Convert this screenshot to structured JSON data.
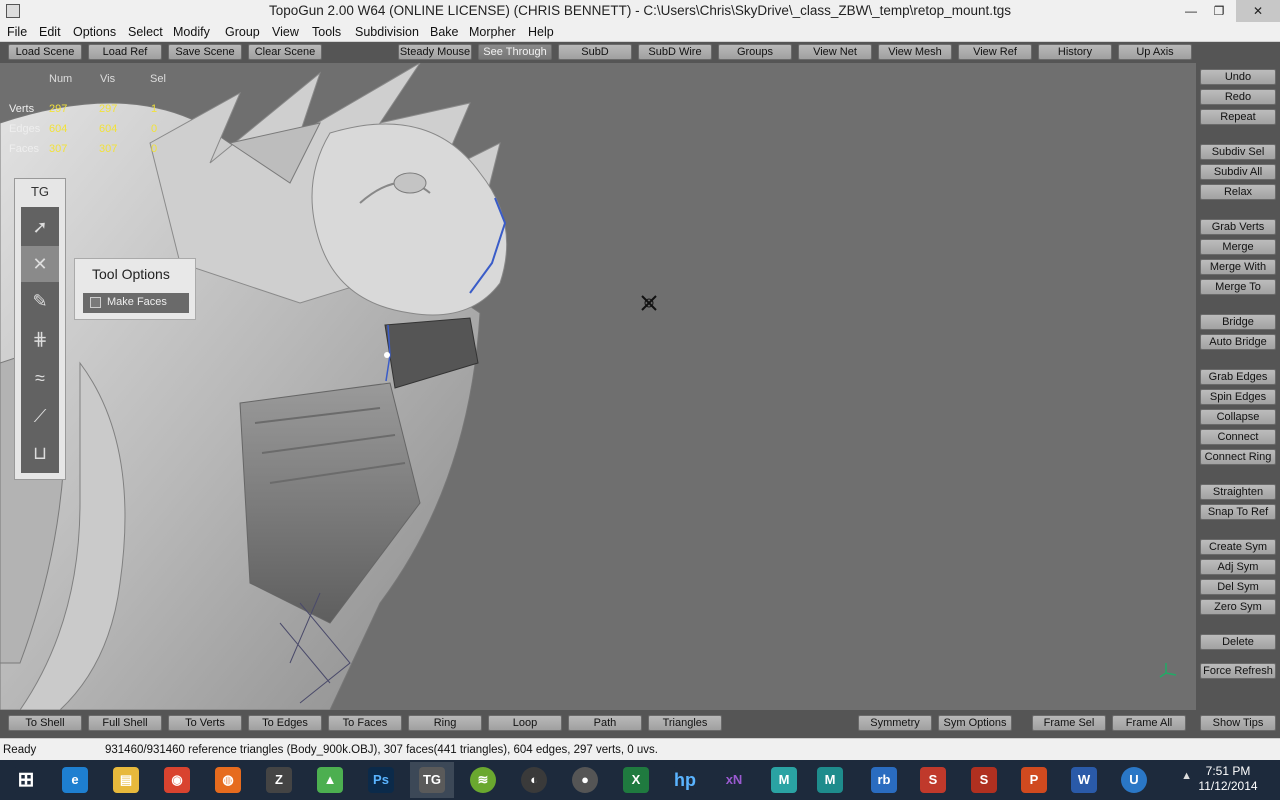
{
  "window": {
    "title": "TopoGun 2.00 W64  (ONLINE LICENSE) (CHRIS BENNETT) - C:\\Users\\Chris\\SkyDrive\\_class_ZBW\\_temp\\retop_mount.tgs",
    "minimize": "—",
    "maximize": "❐",
    "close": "✕"
  },
  "menu": [
    "File",
    "Edit",
    "Options",
    "Select",
    "Modify",
    "Group",
    "View",
    "Tools",
    "Subdivision",
    "Bake",
    "Morpher",
    "Help"
  ],
  "top_toolbar": {
    "left": [
      "Load Scene",
      "Load Ref",
      "Save Scene",
      "Clear Scene"
    ],
    "right": [
      "Steady Mouse",
      "See Through",
      "SubD",
      "SubD Wire",
      "Groups",
      "View Net",
      "View Mesh",
      "View Ref",
      "History",
      "Up Axis"
    ]
  },
  "stats": {
    "headers": [
      "Num",
      "Vis",
      "Sel"
    ],
    "rows": [
      {
        "label": "Verts",
        "num": "297",
        "vis": "297",
        "sel": "1"
      },
      {
        "label": "Edges",
        "num": "604",
        "vis": "604",
        "sel": "0"
      },
      {
        "label": "Faces",
        "num": "307",
        "vis": "307",
        "sel": "0"
      }
    ]
  },
  "tg_panel": {
    "title": "TG",
    "tools": [
      {
        "icon": "select-arrow-icon",
        "glyph": "➚"
      },
      {
        "icon": "cross-tool-icon",
        "glyph": "✕"
      },
      {
        "icon": "pencil-icon",
        "glyph": "✎"
      },
      {
        "icon": "grid-tool-icon",
        "glyph": "⋕"
      },
      {
        "icon": "relax-brush-icon",
        "glyph": "≈"
      },
      {
        "icon": "brush-icon",
        "glyph": "⟋"
      },
      {
        "icon": "measure-icon",
        "glyph": "⊔"
      }
    ]
  },
  "tool_options": {
    "title": "Tool Options",
    "make_faces_label": "Make Faces",
    "make_faces_checked": false
  },
  "right_panel": [
    "Undo",
    "Redo",
    "Repeat",
    "Subdiv Sel",
    "Subdiv All",
    "Relax",
    "Grab Verts",
    "Merge",
    "Merge With",
    "Merge To",
    "Bridge",
    "Auto Bridge",
    "Grab Edges",
    "Spin Edges",
    "Collapse",
    "Connect",
    "Connect Ring",
    "Straighten",
    "Snap To Ref",
    "Create Sym",
    "Adj Sym",
    "Del Sym",
    "Zero Sym",
    "Delete",
    "Force Refresh"
  ],
  "bottom_toolbar": {
    "left": [
      "To Shell",
      "Full Shell",
      "To Verts",
      "To Edges",
      "To Faces",
      "Ring",
      "Loop",
      "Path",
      "Triangles"
    ],
    "right": [
      "Symmetry",
      "Sym Options",
      "Frame Sel",
      "Frame All",
      "Show Tips"
    ]
  },
  "status": {
    "state": "Ready",
    "message": "931460/931460 reference triangles (Body_900k.OBJ), 307 faces(441 triangles), 604 edges, 297 verts, 0 uvs."
  },
  "taskbar": {
    "apps": [
      {
        "name": "start",
        "glyph": "⊞",
        "color": "#1d2a3c"
      },
      {
        "name": "internet-explorer",
        "glyph": "e",
        "color": "#1e7fd0"
      },
      {
        "name": "file-explorer",
        "glyph": "▤",
        "color": "#e7b93c"
      },
      {
        "name": "chrome",
        "glyph": "◉",
        "color": "#d9432f"
      },
      {
        "name": "firefox",
        "glyph": "◍",
        "color": "#e66b1e"
      },
      {
        "name": "zbrush",
        "glyph": "Z",
        "color": "#444444"
      },
      {
        "name": "3d-app",
        "glyph": "▲",
        "color": "#4caf50"
      },
      {
        "name": "photoshop",
        "glyph": "Ps",
        "color": "#0b2a4a"
      },
      {
        "name": "topogun",
        "glyph": "TG",
        "color": "#5a5a5a"
      },
      {
        "name": "spotify",
        "glyph": "≋",
        "color": "#6aa82f"
      },
      {
        "name": "obs",
        "glyph": "◐",
        "color": "#3a3a3a"
      },
      {
        "name": "media-app",
        "glyph": "●",
        "color": "#555555"
      },
      {
        "name": "excel",
        "glyph": "X",
        "color": "#1f7a3f"
      },
      {
        "name": "hp",
        "glyph": "hp",
        "color": "#1d2a3c"
      },
      {
        "name": "xnview",
        "glyph": "xN",
        "color": "#1d2a3c"
      },
      {
        "name": "maya-lt",
        "glyph": "M",
        "color": "#2aa3a3"
      },
      {
        "name": "maya",
        "glyph": "M",
        "color": "#1e8c8c"
      },
      {
        "name": "rb-app",
        "glyph": "rb",
        "color": "#2a6cc0"
      },
      {
        "name": "substance",
        "glyph": "S",
        "color": "#c0392b"
      },
      {
        "name": "substance-2",
        "glyph": "S",
        "color": "#b03020"
      },
      {
        "name": "powerpoint",
        "glyph": "P",
        "color": "#d04a1f"
      },
      {
        "name": "word",
        "glyph": "W",
        "color": "#2a5aa8"
      },
      {
        "name": "unreal",
        "glyph": "U",
        "color": "#2a77c6"
      }
    ],
    "tray": "▲",
    "time": "7:51 PM",
    "date": "11/12/2014"
  }
}
